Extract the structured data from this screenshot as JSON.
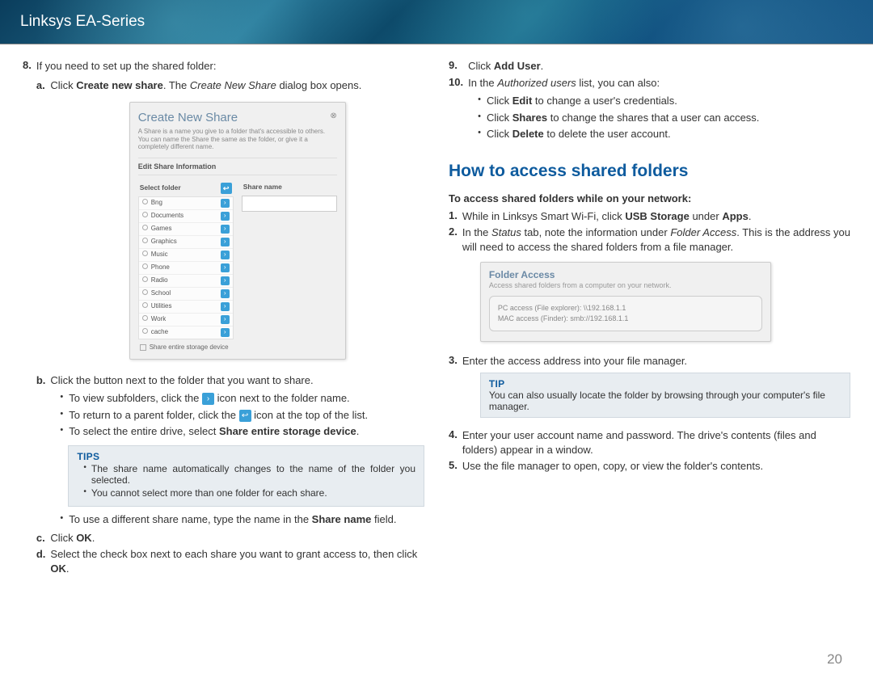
{
  "header": {
    "title": "Linksys EA-Series"
  },
  "pageNumber": "20",
  "left": {
    "step8_intro": "If you need to set up the shared folder:",
    "step8a_pre": "Click ",
    "step8a_bold": "Create new share",
    "step8a_post": ". The ",
    "step8a_italic": "Create New Share",
    "step8a_tail": " dialog box opens.",
    "dialog": {
      "title": "Create New Share",
      "desc": "A Share is a name you give to a folder that's accessible to others. You can name the Share the same as the folder, or give it a completely different name.",
      "section": "Edit Share Information",
      "selectFolder": "Select folder",
      "shareName": "Share name",
      "folders": [
        "Bng",
        "Documents",
        "Games",
        "Graphics",
        "Music",
        "Phone",
        "Radio",
        "School",
        "Utilities",
        "Work",
        "cache"
      ],
      "shareEntire": "Share entire storage device"
    },
    "step8b": "Click the button next to the folder that you want to share.",
    "step8b_sub1_pre": "To view subfolders, click the ",
    "step8b_sub1_post": " icon next to the folder name.",
    "step8b_sub2_pre": "To return to a parent folder, click the ",
    "step8b_sub2_post": " icon at the top of the list.",
    "step8b_sub3_pre": "To select the entire drive, select ",
    "step8b_sub3_bold": "Share entire storage device",
    "step8b_sub3_post": ".",
    "tips_head": "TIPS",
    "tip1": "The share name automatically changes to the name of the folder you selected.",
    "tip2": "You cannot select more than one folder for each share.",
    "step8b_sub4_pre": "To use a different share name, type the name in the ",
    "step8b_sub4_bold": "Share name",
    "step8b_sub4_post": " field.",
    "step8c_pre": "Click ",
    "step8c_bold": "OK",
    "step8c_post": ".",
    "step8d_pre": "Select the check box next to each share you want to grant access to, then click ",
    "step8d_bold": "OK",
    "step8d_post": "."
  },
  "right": {
    "step9_pre": "Click ",
    "step9_bold": "Add User",
    "step9_post": ".",
    "step10_pre": "In the ",
    "step10_italic": "Authorized users",
    "step10_post": " list, you can also:",
    "step10_b1_pre": "Click ",
    "step10_b1_bold": "Edit",
    "step10_b1_post": " to change a user's credentials.",
    "step10_b2_pre": "Click ",
    "step10_b2_bold": "Shares",
    "step10_b2_post": " to change the shares that a user can access.",
    "step10_b3_pre": "Click ",
    "step10_b3_bold": "Delete",
    "step10_b3_post": " to delete the user account.",
    "section_title": "How to access shared folders",
    "subhead": "To access shared folders while on your network:",
    "a_step1_pre": "While in Linksys Smart Wi-Fi, click ",
    "a_step1_bold1": "USB Storage",
    "a_step1_mid": " under ",
    "a_step1_bold2": "Apps",
    "a_step1_post": ".",
    "a_step2_pre": "In the ",
    "a_step2_it1": "Status",
    "a_step2_mid": " tab, note the information under ",
    "a_step2_it2": "Folder Access",
    "a_step2_post": ". This is the address you will need to access the shared folders from a file manager.",
    "folderAccess": {
      "title": "Folder Access",
      "desc": "Access shared folders from a computer on your network.",
      "pc": "PC access (File explorer): \\\\192.168.1.1",
      "mac": "MAC access (Finder): smb://192.168.1.1"
    },
    "a_step3": "Enter the access address into your file manager.",
    "tip_head": "TIP",
    "tip_text": "You can also usually locate the folder by browsing through your computer's file manager.",
    "a_step4": "Enter your user account name and password. The drive's contents (files and folders) appear in a window.",
    "a_step5": "Use the file manager to open, copy, or view the folder's contents."
  }
}
